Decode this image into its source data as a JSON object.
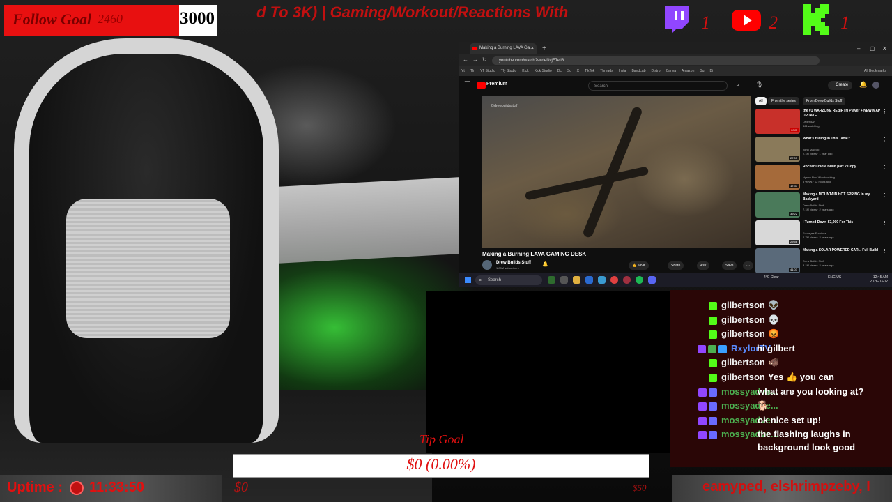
{
  "overlay": {
    "follow_goal": {
      "label": "Follow Goal",
      "current": "2460",
      "target": "3000",
      "progress": 0.82
    },
    "ticker_top": "d To 3K) | Gaming/Workout/Reactions With",
    "social": [
      {
        "icon": "twitch-icon",
        "count": "1",
        "color": "#9146ff"
      },
      {
        "icon": "youtube-icon",
        "count": "2",
        "color": "#ff0000"
      },
      {
        "icon": "kick-icon",
        "count": "1",
        "color": "#53fc18"
      }
    ],
    "tip_goal": {
      "title": "Tip Goal",
      "amount": "$0 (0.00%)",
      "min": "$0",
      "max": "$50"
    },
    "uptime": {
      "label": "Uptime :",
      "time": "11:33:50"
    },
    "ticker_bottom": "eamyped, elshrimpzeby, I"
  },
  "browser": {
    "tab_title": "Making a Burning LAVA Ga...",
    "tab_close": "×",
    "new_tab": "+",
    "window_controls": [
      "–",
      "▢",
      "✕"
    ],
    "nav": [
      "←",
      "→",
      "↻"
    ],
    "url": "youtube.com/watch?v=deNvjFTeiI8",
    "bookmarks": [
      "Yt",
      "Tfr",
      "YT Studio",
      "Tfy Studio",
      "Kick",
      "Kick Studio",
      "Dc",
      "Sc",
      "X",
      "TikTok",
      "Threads",
      "Insta",
      "BandLab",
      "Distro",
      "Canva",
      "Amazon",
      "Su",
      "Bi"
    ],
    "all_bookmarks": "All Bookmarks",
    "youtube": {
      "menu": "☰",
      "brand": "Premium",
      "search_placeholder": "Search",
      "search_icon": "⌕",
      "mic_icon": "🎙",
      "create": "+ Create",
      "bell": "🔔",
      "video_title": "Making a Burning LAVA GAMING DESK",
      "watermark": "@drewbuildsstuff",
      "channel": "Drew Builds Stuff",
      "subscribers": "1.88M subscribers",
      "likes": "189K",
      "actions": [
        "Share",
        "Ask",
        "Save",
        "⋯"
      ],
      "chips": [
        "All",
        "From the series",
        "From Drew Builds Stuff"
      ],
      "recommendations": [
        {
          "title": "the #1 WARZONE REBIRTH Player + NEW MAP UPDATE",
          "channel": "LegendAY",
          "meta": "461 watching",
          "thumb": "#c8302a",
          "badge": "LIVE"
        },
        {
          "title": "What's Hiding in This Table?",
          "channel": "John Malecki",
          "meta": "2.1M views · 1 year ago",
          "thumb": "#8a7a5a",
          "badge": "27:03"
        },
        {
          "title": "Rocker Cradle Build part 2 Copy",
          "channel": "Hyrum Finn Woodworking",
          "meta": "5 views · 12 hours ago",
          "thumb": "#a56a3a",
          "badge": "17:33"
        },
        {
          "title": "Making a MOUNTAIN HOT SPRING in my Backyard",
          "channel": "Drew Builds Stuff",
          "meta": "7.1M views · 2 years ago",
          "thumb": "#4a7a5a",
          "badge": "39:22"
        },
        {
          "title": "I Turned Down $7,000 For This",
          "channel": "Foureyes Furniture",
          "meta": "2.7M views · 2 years ago",
          "thumb": "#d8d8d8",
          "badge": "29:56"
        },
        {
          "title": "Making a SOLAR POWERED CAR... Full Build",
          "channel": "Drew Builds Stuff",
          "meta": "3.1M views · 2 years ago",
          "thumb": "#5a6a7a",
          "badge": "41:03"
        }
      ]
    },
    "taskbar": {
      "search": "Search",
      "weather": "4°C Clear",
      "lang": "ENG US",
      "time": "12:45 AM",
      "date": "2026-03-02"
    }
  },
  "chat": [
    {
      "badges": [
        "#53fc18"
      ],
      "user": "gilbertson",
      "user_color": "#f2f2f2",
      "message": "👽"
    },
    {
      "badges": [
        "#53fc18"
      ],
      "user": "gilbertson",
      "user_color": "#f2f2f2",
      "message": "💀"
    },
    {
      "badges": [
        "#53fc18"
      ],
      "user": "gilbertson",
      "user_color": "#f2f2f2",
      "message": "😡"
    },
    {
      "badges": [
        "#9146ff",
        "#4caf50",
        "#3aa0ff"
      ],
      "user": "RxylorTV",
      "user_color": "#5a8cff",
      "message": "hi gilbert"
    },
    {
      "badges": [
        "#53fc18"
      ],
      "user": "gilbertson",
      "user_color": "#f2f2f2",
      "message": "🐗"
    },
    {
      "badges": [
        "#53fc18"
      ],
      "user": "gilbertson",
      "user_color": "#f2f2f2",
      "message": "Yes 👍 you can"
    },
    {
      "badges": [
        "#9146ff",
        "#6a6aff"
      ],
      "user": "mossyadve...",
      "user_color": "#4caf50",
      "message": "what are you looking at?"
    },
    {
      "badges": [
        "#9146ff",
        "#6a6aff"
      ],
      "user": "mossyadve...",
      "user_color": "#4caf50",
      "message": "🐕"
    },
    {
      "badges": [
        "#9146ff",
        "#6a6aff"
      ],
      "user": "mossyadve...",
      "user_color": "#4caf50",
      "message": "ok nice set up!"
    },
    {
      "badges": [
        "#9146ff",
        "#6a6aff"
      ],
      "user": "mossyadve...",
      "user_color": "#4caf50",
      "message": "the flashing laughs in background look good"
    }
  ]
}
